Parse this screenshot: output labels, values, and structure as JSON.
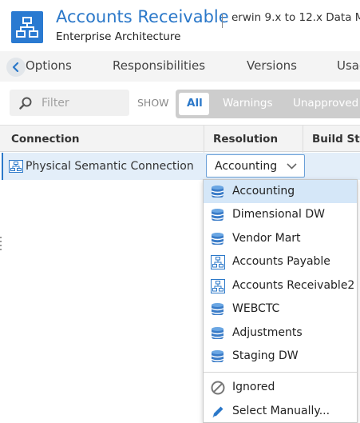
{
  "header": {
    "title": "Accounts Receivable",
    "context": "erwin 9.x to 12.x Data M",
    "subtitle": "Enterprise Architecture",
    "icon": "model-hierarchy-icon"
  },
  "tabs": [
    {
      "label": "Options"
    },
    {
      "label": "Responsibilities"
    },
    {
      "label": "Versions"
    },
    {
      "label": "Usag"
    }
  ],
  "filter": {
    "placeholder": "Filter",
    "show_label": "SHOW",
    "segments": [
      "All",
      "Warnings",
      "Unapproved"
    ],
    "active_segment": "All"
  },
  "table": {
    "columns": [
      "Connection",
      "Resolution",
      "Build Sta"
    ],
    "rows": [
      {
        "connection": "Physical Semantic Connection",
        "resolution": "Accounting",
        "icon": "model-hierarchy-icon"
      }
    ]
  },
  "dropdown": {
    "selected": "Accounting",
    "options": [
      {
        "label": "Accounting",
        "icon": "database-icon"
      },
      {
        "label": "Dimensional DW",
        "icon": "database-icon"
      },
      {
        "label": "Vendor Mart",
        "icon": "database-icon"
      },
      {
        "label": "Accounts Payable",
        "icon": "model-hierarchy-icon"
      },
      {
        "label": "Accounts Receivable2",
        "icon": "model-hierarchy-icon"
      },
      {
        "label": "WEBCTC",
        "icon": "database-icon"
      },
      {
        "label": "Adjustments",
        "icon": "database-icon"
      },
      {
        "label": "Staging DW",
        "icon": "database-icon"
      }
    ],
    "extra": [
      {
        "label": "Ignored",
        "icon": "ban-icon"
      },
      {
        "label": "Select Manually...",
        "icon": "pencil-icon"
      }
    ]
  },
  "colors": {
    "accent": "#2b78c9",
    "selected_row": "#e3eef9",
    "selected_option": "#d5e7f8"
  }
}
